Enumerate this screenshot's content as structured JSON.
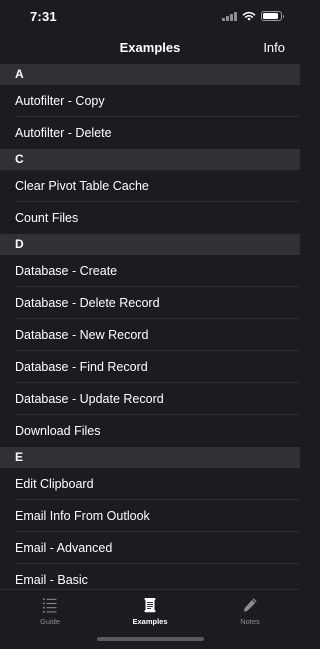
{
  "status_bar": {
    "time": "7:31",
    "icons": [
      "cellular-signal-icon",
      "wifi-icon",
      "battery-icon"
    ]
  },
  "nav": {
    "title": "Examples",
    "info_label": "Info"
  },
  "list": {
    "sections": [
      {
        "header": "A",
        "items": [
          "Autofilter - Copy",
          "Autofilter - Delete"
        ]
      },
      {
        "header": "C",
        "items": [
          "Clear Pivot Table Cache",
          "Count Files"
        ]
      },
      {
        "header": "D",
        "items": [
          "Database - Create",
          "Database - Delete Record",
          "Database - New Record",
          "Database - Find Record",
          "Database - Update Record",
          "Download Files"
        ]
      },
      {
        "header": "E",
        "items": [
          "Edit Clipboard",
          "Email Info From Outlook",
          "Email - Advanced",
          "Email - Basic"
        ]
      }
    ]
  },
  "tab_bar": {
    "tabs": [
      {
        "label": "Guide",
        "icon": "list-icon",
        "selected": false
      },
      {
        "label": "Examples",
        "icon": "scroll-icon",
        "selected": true
      },
      {
        "label": "Notes",
        "icon": "pencil-icon",
        "selected": false
      }
    ]
  },
  "colors": {
    "background": "#1c1b22",
    "section_header": "#303036",
    "separator": "#2d2c33",
    "text": "#ffffff",
    "inactive_tab": "#8e8d93"
  }
}
